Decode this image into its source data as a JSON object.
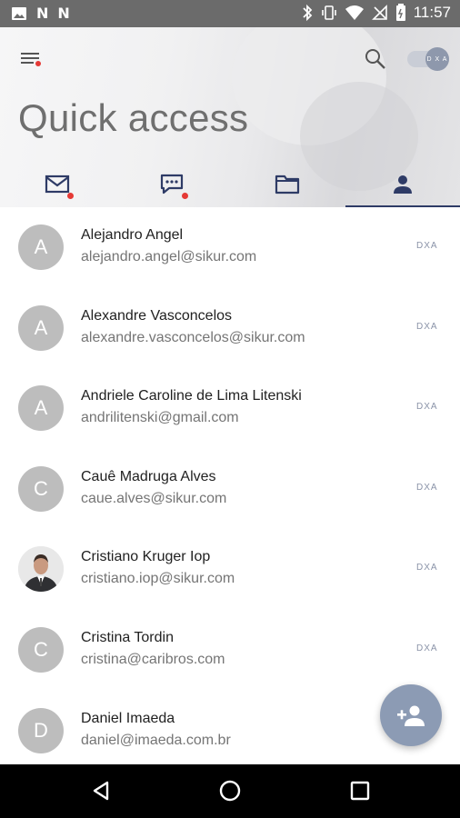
{
  "status_bar": {
    "time": "11:57",
    "left_icons": [
      "N",
      "N"
    ]
  },
  "header": {
    "title": "Quick access",
    "toggle_label": "D X A"
  },
  "tabs": [
    {
      "name": "mail",
      "icon": "mail-icon",
      "badge": true
    },
    {
      "name": "chat",
      "icon": "chat-icon",
      "badge": true
    },
    {
      "name": "folder",
      "icon": "folder-icon",
      "badge": false
    },
    {
      "name": "contacts",
      "icon": "person-icon",
      "badge": false,
      "active": true
    }
  ],
  "contacts": [
    {
      "initial": "A",
      "name": "Alejandro Angel",
      "email": "alejandro.angel@sikur.com",
      "badge": "DXA"
    },
    {
      "initial": "A",
      "name": "Alexandre Vasconcelos",
      "email": "alexandre.vasconcelos@sikur.com",
      "badge": "DXA"
    },
    {
      "initial": "A",
      "name": "Andriele Caroline de Lima Litenski",
      "email": "andrilitenski@gmail.com",
      "badge": "DXA"
    },
    {
      "initial": "C",
      "name": "Cauê Madruga Alves",
      "email": "caue.alves@sikur.com",
      "badge": "DXA"
    },
    {
      "initial": "",
      "name": "Cristiano Kruger Iop",
      "email": "cristiano.iop@sikur.com",
      "badge": "DXA",
      "photo": true
    },
    {
      "initial": "C",
      "name": "Cristina Tordin",
      "email": "cristina@caribros.com",
      "badge": "DXA"
    },
    {
      "initial": "D",
      "name": "Daniel Imaeda",
      "email": "daniel@imaeda.com.br",
      "badge": ""
    }
  ],
  "colors": {
    "accent": "#2e3b66",
    "fab": "#8c9bb4",
    "avatar": "#bdbdbd",
    "notification": "#e53935",
    "status_bar": "#6b6b6b"
  }
}
